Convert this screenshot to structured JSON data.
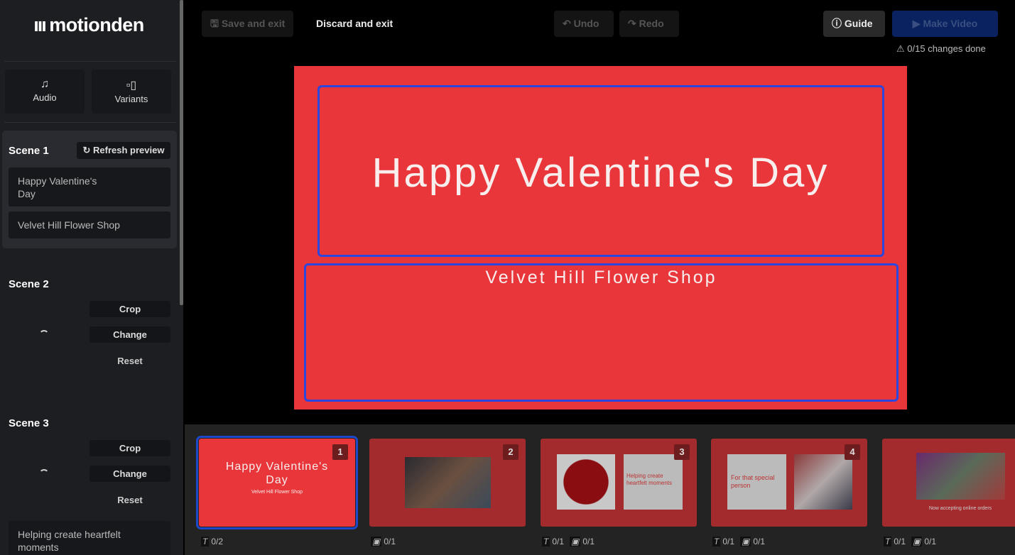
{
  "app": {
    "logo": "motionden"
  },
  "sidebar": {
    "tools": [
      {
        "label": "Audio",
        "icon": "music-note-icon"
      },
      {
        "label": "Variants",
        "icon": "variants-icon"
      }
    ],
    "scene1": {
      "title": "Scene 1",
      "refresh": "Refresh preview",
      "fields": [
        "Happy Valentine's Day",
        "Velvet Hill Flower Shop"
      ]
    },
    "scene2": {
      "title": "Scene 2",
      "crop": "Crop",
      "change": "Change",
      "reset": "Reset"
    },
    "scene3": {
      "title": "Scene 3",
      "crop": "Crop",
      "change": "Change",
      "reset": "Reset",
      "field": "Helping create heartfelt moments"
    }
  },
  "toolbar": {
    "save": "Save and exit",
    "discard": "Discard and exit",
    "undo": "Undo",
    "redo": "Redo",
    "guide": "Guide",
    "make_video": "Make Video",
    "changes": "0/15 changes done"
  },
  "canvas": {
    "title": "Happy Valentine's Day",
    "subtitle": "Velvet Hill Flower Shop",
    "bg": "#e8363a",
    "selection": "#2b47e0"
  },
  "thumbnails": [
    {
      "num": "1",
      "title": "Happy Valentine's Day",
      "sub": "Velvet Hill Flower Shop",
      "counts": [
        {
          "icon": "text-icon",
          "v": "0/2"
        }
      ]
    },
    {
      "num": "2",
      "counts": [
        {
          "icon": "image-icon",
          "v": "0/1"
        }
      ]
    },
    {
      "num": "3",
      "text": "Helping create heartfelt moments",
      "counts": [
        {
          "icon": "text-icon",
          "v": "0/1"
        },
        {
          "icon": "image-icon",
          "v": "0/1"
        }
      ]
    },
    {
      "num": "4",
      "text": "For that special person",
      "counts": [
        {
          "icon": "text-icon",
          "v": "0/1"
        },
        {
          "icon": "image-icon",
          "v": "0/1"
        }
      ]
    },
    {
      "text": "Now accepting online orders",
      "counts": [
        {
          "icon": "text-icon",
          "v": "0/1"
        },
        {
          "icon": "image-icon",
          "v": "0/1"
        }
      ]
    }
  ]
}
